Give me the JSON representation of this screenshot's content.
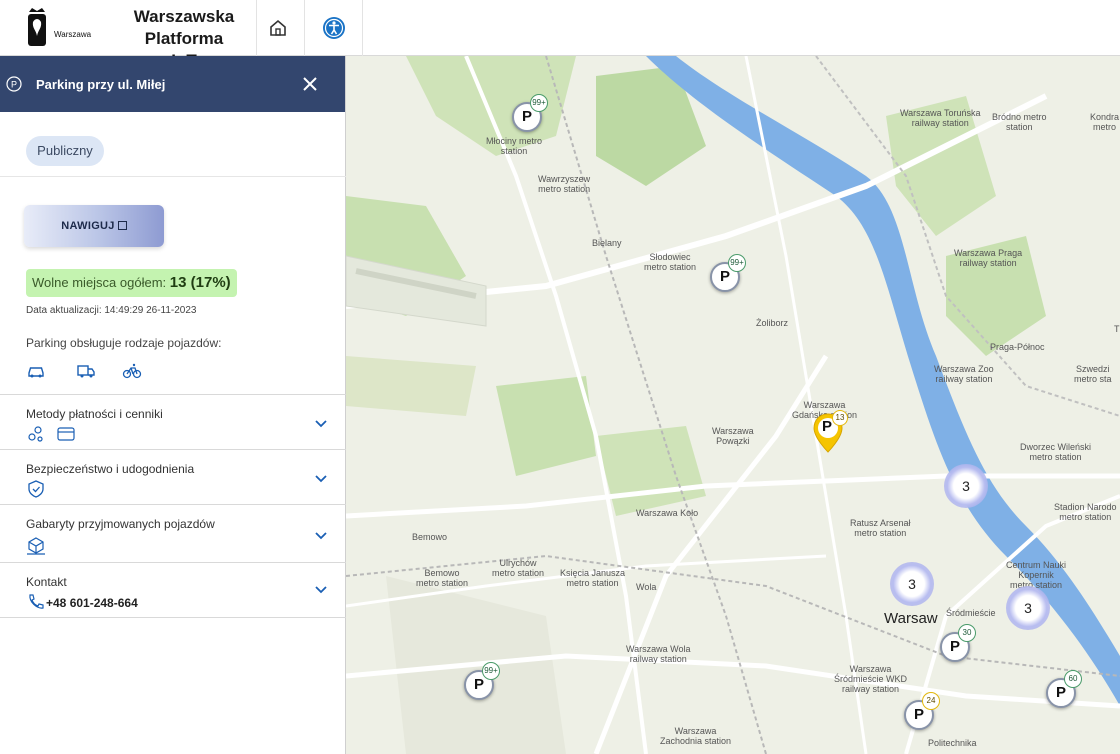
{
  "header": {
    "logo_text": "Warszawa",
    "title_line1": "Warszawska Platforma",
    "title_line2": "IoT"
  },
  "panel": {
    "title": "Parking przy ul. Miłej",
    "badge": "Publiczny",
    "navigate_label": "NAWIGUJ",
    "free_label": "Wolne miejsca ogółem:",
    "free_value": "13 (17%)",
    "updated": "Data aktualizacji: 14:49:29 26-11-2023",
    "vehicles_label": "Parking obsługuje rodzaje pojazdów:",
    "vehicle_icons": [
      "car-icon",
      "truck-icon",
      "bicycle-icon"
    ],
    "sections": [
      {
        "title": "Metody płatności i cenniki",
        "icons": [
          "coins-icon",
          "card-icon"
        ]
      },
      {
        "title": "Bezpieczeństwo i udogodnienia",
        "icons": [
          "shield-icon"
        ]
      },
      {
        "title": "Gabaryty przyjmowanych pojazdów",
        "icons": [
          "box-icon"
        ]
      },
      {
        "title": "Kontakt",
        "phone": "+48 601-248-664",
        "icons": [
          "phone-icon"
        ]
      }
    ]
  },
  "map": {
    "labels": {
      "mlociny": "Młociny metro\nstation",
      "wawrzyszew": "Wawrzyszew\nmetro station",
      "bielany": "Bielany",
      "slodowiec": "Słodowiec\nmetro station",
      "zoliborz": "Żoliborz",
      "torunska": "Warszawa Toruńska\nrailway station",
      "brodno": "Bródno metro\nstation",
      "kondr": "Kondra\nmetro",
      "praga": "Warszawa Praga\nrailway station",
      "t": "T",
      "pragapn": "Praga-Północ",
      "zoo": "Warszawa Zoo\nrailway station",
      "szwedz": "Szwedzi\nmetro sta",
      "gdanska": "Warszawa\nGdańska station",
      "powazki": "Warszawa\nPowązki",
      "wilenski": "Dworzec Wileński\nmetro station",
      "narodowy": "Stadion Narodo\nmetro station",
      "kolo": "Warszawa Koło",
      "ratusz": "Ratusz Arsenał\nmetro station",
      "bemowo": "Bemowo",
      "bemowo_m": "Bemowo\nmetro station",
      "ulrychow": "Ulrychów\nmetro station",
      "ksiecia": "Księcia Janusza\nmetro station",
      "wola": "Wola",
      "warsaw": "Warsaw",
      "srodmiescie": "Śródmieście",
      "kopernik": "Centrum Nauki\nKopernik\nmetro station",
      "wola_rs": "Warszawa Wola\nrailway station",
      "wkd": "Warszawa\nŚródmieście WKD\nrailway station",
      "zachodnia": "Warszawa\nZachodnia station",
      "politechnika": "Politechnika"
    },
    "pins": [
      {
        "id": "mlociny",
        "letter": "P",
        "count": "99+"
      },
      {
        "id": "slodowiec",
        "letter": "P",
        "count": "99+"
      },
      {
        "id": "wola",
        "letter": "P",
        "count": "99+"
      },
      {
        "id": "srodmiescie",
        "letter": "P",
        "count": "30"
      },
      {
        "id": "wkd",
        "letter": "P",
        "count": "24"
      },
      {
        "id": "powisle",
        "letter": "P",
        "count": "60"
      }
    ],
    "selected_pin": {
      "letter": "P",
      "count": "13"
    },
    "clusters": [
      "3",
      "3",
      "3"
    ]
  }
}
